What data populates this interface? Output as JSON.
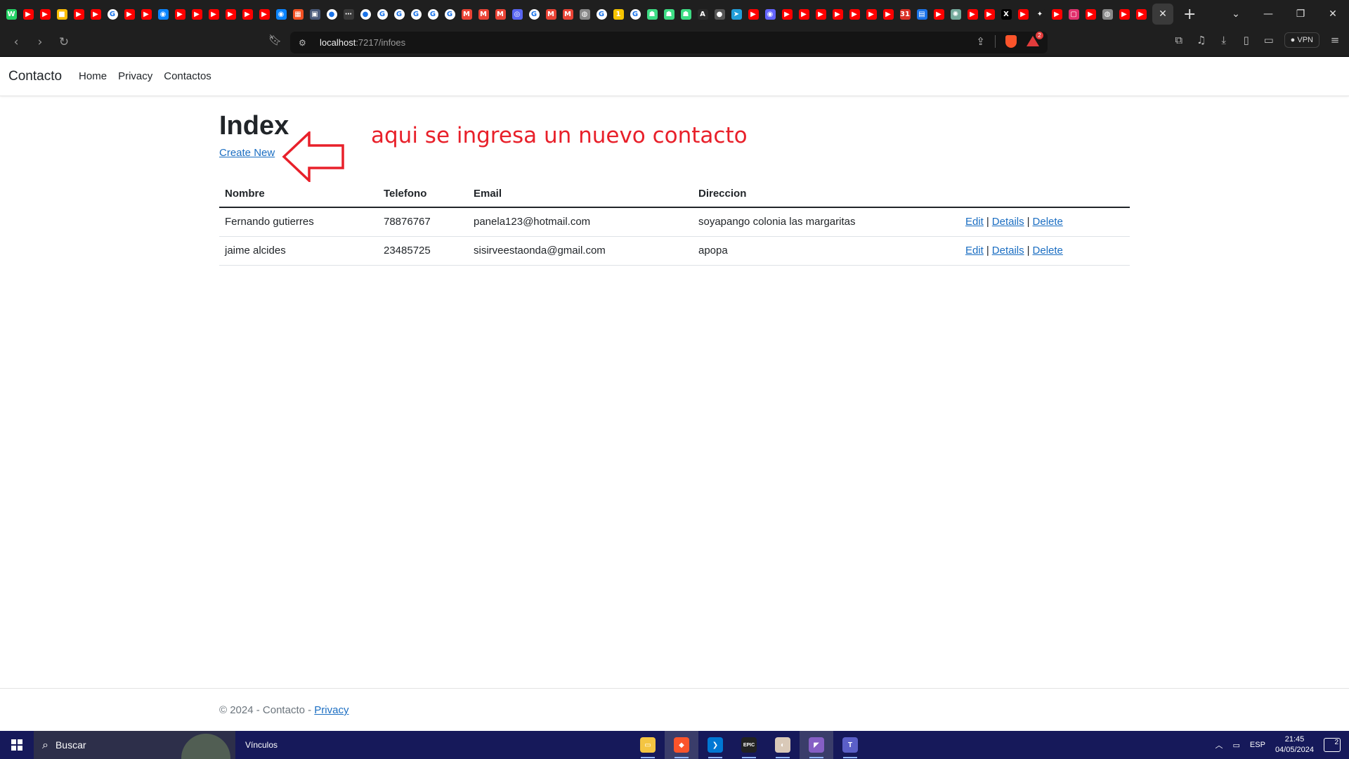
{
  "browser": {
    "tab_favicons": [
      {
        "icon": "whatsapp-icon",
        "color": "#25d366",
        "glyph": "W"
      },
      {
        "icon": "youtube-icon",
        "color": "#ff0000",
        "glyph": "▶"
      },
      {
        "icon": "youtube-icon",
        "color": "#ff0000",
        "glyph": "▶"
      },
      {
        "icon": "keep-icon",
        "color": "#fbbc04",
        "glyph": "■"
      },
      {
        "icon": "youtube-icon",
        "color": "#ff0000",
        "glyph": "▶"
      },
      {
        "icon": "youtube-icon",
        "color": "#ff0000",
        "glyph": "▶"
      },
      {
        "icon": "google-icon",
        "color": "#ffffff",
        "glyph": "G"
      },
      {
        "icon": "youtube-icon",
        "color": "#ff0000",
        "glyph": "▶"
      },
      {
        "icon": "youtube-icon",
        "color": "#ff0000",
        "glyph": "▶"
      },
      {
        "icon": "messenger-icon",
        "color": "#0a84ff",
        "glyph": "◉"
      },
      {
        "icon": "youtube-icon",
        "color": "#ff0000",
        "glyph": "▶"
      },
      {
        "icon": "youtube-icon",
        "color": "#ff0000",
        "glyph": "▶"
      },
      {
        "icon": "youtube-icon",
        "color": "#ff0000",
        "glyph": "▶"
      },
      {
        "icon": "youtube-icon",
        "color": "#ff0000",
        "glyph": "▶"
      },
      {
        "icon": "youtube-icon",
        "color": "#ff0000",
        "glyph": "▶"
      },
      {
        "icon": "youtube-icon",
        "color": "#ff0000",
        "glyph": "▶"
      },
      {
        "icon": "messenger-icon",
        "color": "#0a84ff",
        "glyph": "◉"
      },
      {
        "icon": "microsoft-icon",
        "color": "#f25022",
        "glyph": "▦"
      },
      {
        "icon": "window-icon",
        "color": "#4a5a7a",
        "glyph": "▣"
      },
      {
        "icon": "github-icon",
        "color": "#ffffff",
        "glyph": "●"
      },
      {
        "icon": "dots-icon",
        "color": "#3a3a3a",
        "glyph": "⋯"
      },
      {
        "icon": "github-icon",
        "color": "#ffffff",
        "glyph": "●"
      },
      {
        "icon": "google-icon",
        "color": "#ffffff",
        "glyph": "G"
      },
      {
        "icon": "google-icon",
        "color": "#ffffff",
        "glyph": "G"
      },
      {
        "icon": "google-icon",
        "color": "#ffffff",
        "glyph": "G"
      },
      {
        "icon": "google-icon",
        "color": "#ffffff",
        "glyph": "G"
      },
      {
        "icon": "google-icon",
        "color": "#ffffff",
        "glyph": "G"
      },
      {
        "icon": "gmail-icon",
        "color": "#ea4335",
        "glyph": "M"
      },
      {
        "icon": "gmail-icon",
        "color": "#ea4335",
        "glyph": "M"
      },
      {
        "icon": "gmail-icon",
        "color": "#ea4335",
        "glyph": "M"
      },
      {
        "icon": "discord-icon",
        "color": "#5865f2",
        "glyph": "◎"
      },
      {
        "icon": "google-icon",
        "color": "#ffffff",
        "glyph": "G"
      },
      {
        "icon": "gmail-icon",
        "color": "#ea4335",
        "glyph": "M"
      },
      {
        "icon": "gmail-icon",
        "color": "#ea4335",
        "glyph": "M"
      },
      {
        "icon": "globe-icon",
        "color": "#888888",
        "glyph": "◍"
      },
      {
        "icon": "google-icon",
        "color": "#ffffff",
        "glyph": "G"
      },
      {
        "icon": "number-one-icon",
        "color": "#f5c400",
        "glyph": "1"
      },
      {
        "icon": "google-icon",
        "color": "#ffffff",
        "glyph": "G"
      },
      {
        "icon": "android-icon",
        "color": "#3ddc84",
        "glyph": "☗"
      },
      {
        "icon": "android-icon",
        "color": "#3ddc84",
        "glyph": "☗"
      },
      {
        "icon": "android-icon",
        "color": "#3ddc84",
        "glyph": "☗"
      },
      {
        "icon": "af-icon",
        "color": "#2a2a2a",
        "glyph": "A"
      },
      {
        "icon": "github-icon",
        "color": "#555555",
        "glyph": "●"
      },
      {
        "icon": "telegram-icon",
        "color": "#229ed9",
        "glyph": "➤"
      },
      {
        "icon": "youtube-icon",
        "color": "#ff0000",
        "glyph": "▶"
      },
      {
        "icon": "mastodon-icon",
        "color": "#6364ff",
        "glyph": "◉"
      },
      {
        "icon": "youtube-icon",
        "color": "#ff0000",
        "glyph": "▶"
      },
      {
        "icon": "youtube-icon",
        "color": "#ff0000",
        "glyph": "▶"
      },
      {
        "icon": "youtube-icon",
        "color": "#ff0000",
        "glyph": "▶"
      },
      {
        "icon": "youtube-icon",
        "color": "#ff0000",
        "glyph": "▶"
      },
      {
        "icon": "youtube-icon",
        "color": "#ff0000",
        "glyph": "▶"
      },
      {
        "icon": "youtube-icon",
        "color": "#ff0000",
        "glyph": "▶"
      },
      {
        "icon": "youtube-icon",
        "color": "#ff0000",
        "glyph": "▶"
      },
      {
        "icon": "calendar-icon",
        "color": "#d93025",
        "glyph": "31"
      },
      {
        "icon": "docs-icon",
        "color": "#1a73e8",
        "glyph": "▤"
      },
      {
        "icon": "youtube-icon",
        "color": "#ff0000",
        "glyph": "▶"
      },
      {
        "icon": "chatgpt-icon",
        "color": "#74aa9c",
        "glyph": "✺"
      },
      {
        "icon": "youtube-icon",
        "color": "#ff0000",
        "glyph": "▶"
      },
      {
        "icon": "youtube-icon",
        "color": "#ff0000",
        "glyph": "▶"
      },
      {
        "icon": "x-icon",
        "color": "#000000",
        "glyph": "X"
      },
      {
        "icon": "youtube-icon",
        "color": "#ff0000",
        "glyph": "▶"
      },
      {
        "icon": "gemini-icon",
        "color": "#1f1f1f",
        "glyph": "✦"
      },
      {
        "icon": "youtube-icon",
        "color": "#ff0000",
        "glyph": "▶"
      },
      {
        "icon": "instagram-icon",
        "color": "#e1306c",
        "glyph": "▢"
      },
      {
        "icon": "youtube-icon",
        "color": "#ff0000",
        "glyph": "▶"
      },
      {
        "icon": "globe-icon",
        "color": "#888888",
        "glyph": "◍"
      },
      {
        "icon": "youtube-icon",
        "color": "#ff0000",
        "glyph": "▶"
      },
      {
        "icon": "youtube-icon",
        "color": "#ff0000",
        "glyph": "▶"
      }
    ],
    "active_tab_close": "✕",
    "new_tab": "+",
    "url_host": "localhost",
    "url_path": ":7217/infoes",
    "rewards_count": "2",
    "vpn_label": "VPN"
  },
  "site": {
    "brand": "Contacto",
    "nav": [
      "Home",
      "Privacy",
      "Contactos"
    ]
  },
  "main": {
    "title": "Index",
    "create_link": "Create New",
    "annotation": "aqui se ingresa un nuevo contacto",
    "table": {
      "headers": [
        "Nombre",
        "Telefono",
        "Email",
        "Direccion",
        ""
      ],
      "rows": [
        {
          "nombre": "Fernando gutierres",
          "telefono": "78876767",
          "email": "panela123@hotmail.com",
          "direccion": "soyapango colonia las margaritas"
        },
        {
          "nombre": "jaime alcides",
          "telefono": "23485725",
          "email": "sisirveestaonda@gmail.com",
          "direccion": "apopa"
        }
      ],
      "actions": [
        "Edit",
        "Details",
        "Delete"
      ],
      "action_separator": "|"
    }
  },
  "footer": {
    "text": "© 2024 - Contacto - ",
    "link": "Privacy"
  },
  "taskbar": {
    "search_placeholder": "Buscar",
    "links_label": "Vínculos",
    "apps": [
      {
        "icon": "file-explorer-icon",
        "color": "#f4c542",
        "glyph": "▭",
        "active": false
      },
      {
        "icon": "brave-icon",
        "color": "#fb542b",
        "glyph": "◆",
        "active": true
      },
      {
        "icon": "vscode-icon",
        "color": "#0078d4",
        "glyph": "❯",
        "active": false
      },
      {
        "icon": "epic-games-icon",
        "color": "#222222",
        "glyph": "EPIC",
        "active": false
      },
      {
        "icon": "game-icon",
        "color": "#d9c9b8",
        "glyph": "◐",
        "active": false
      },
      {
        "icon": "visual-studio-icon",
        "color": "#865fc5",
        "glyph": "◤",
        "active": true
      },
      {
        "icon": "teams-icon",
        "color": "#5b5fc7",
        "glyph": "T",
        "active": false
      }
    ],
    "language": "ESP",
    "time": "21:45",
    "date": "04/05/2024",
    "notifications": "2"
  },
  "colors": {
    "link": "#1b6ec2",
    "annotation": "#e8202a",
    "taskbar": "#16195a",
    "chrome": "#1f1f1f"
  }
}
